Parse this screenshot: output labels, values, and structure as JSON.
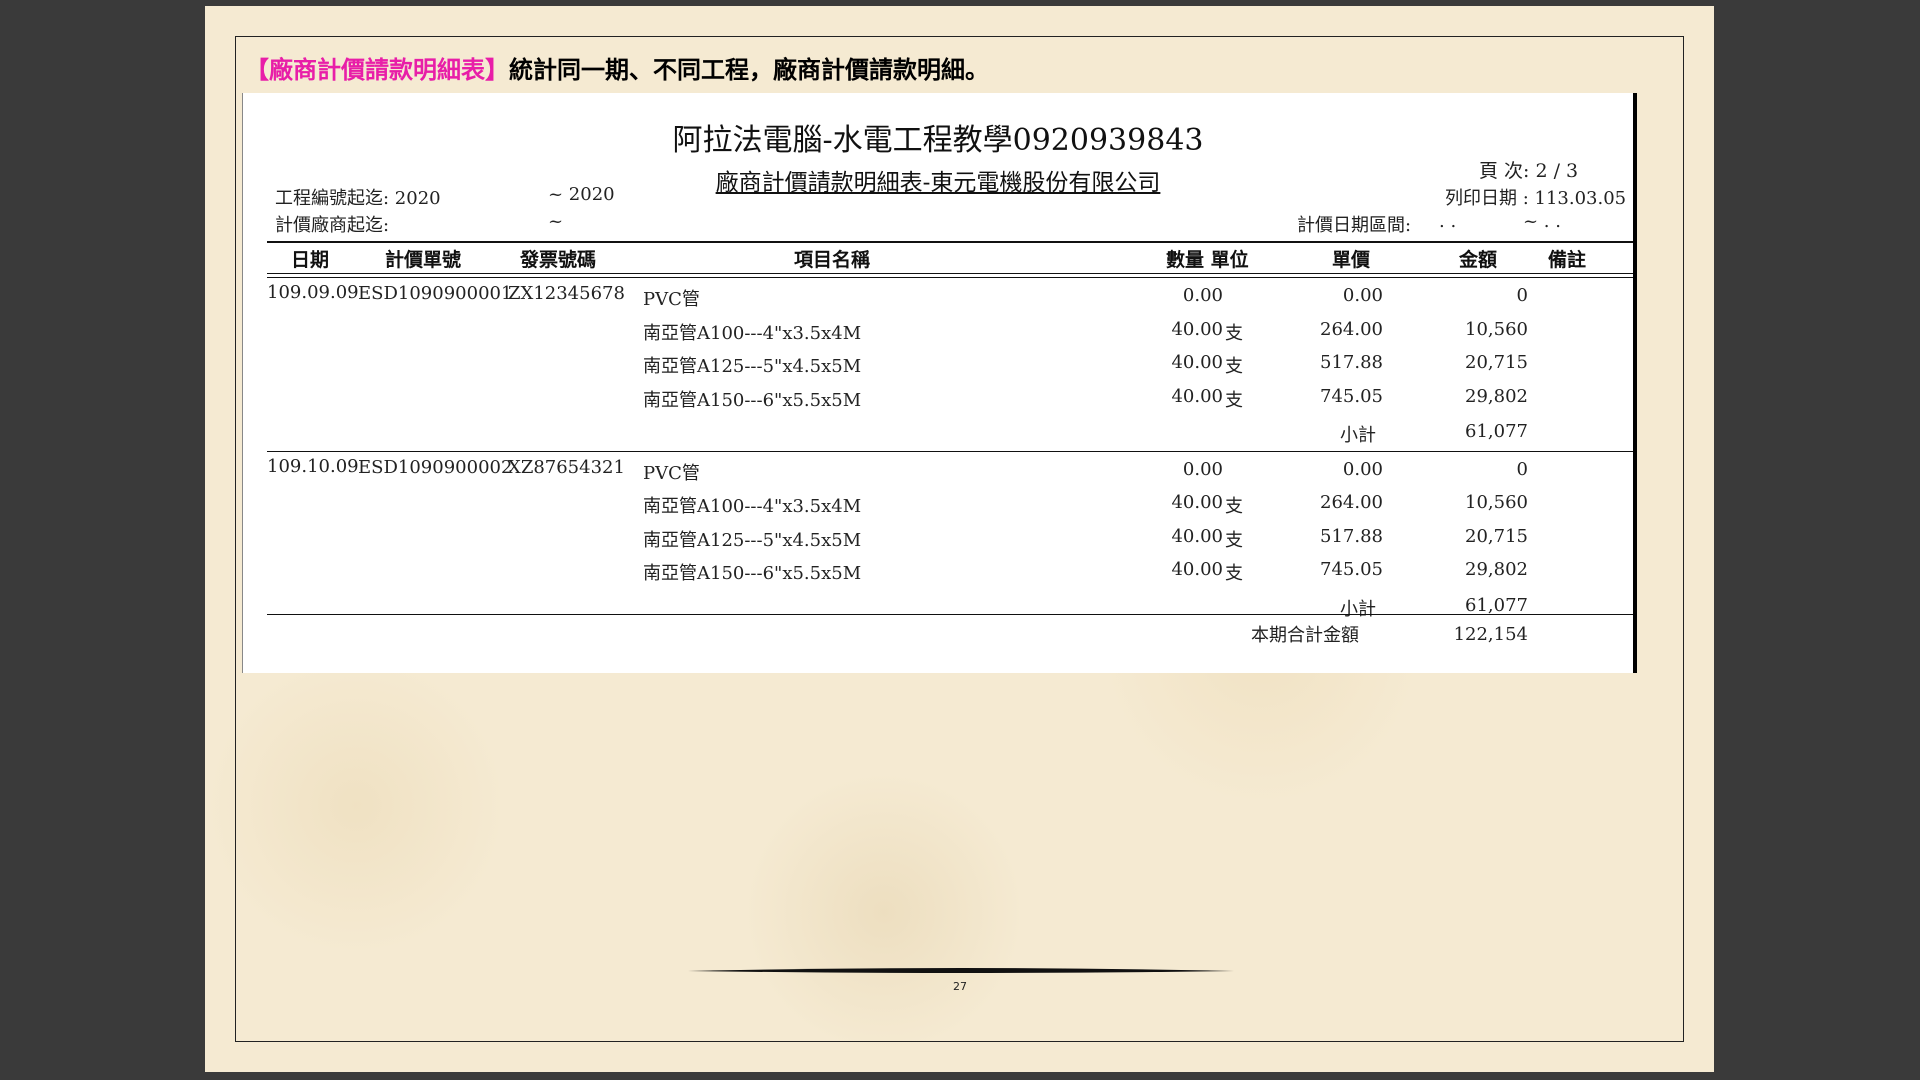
{
  "heading": {
    "tag": "【廠商計價請款明細表】",
    "text": "統計同一期、不同工程，廠商計價請款明細。"
  },
  "report": {
    "title": "阿拉法電腦-水電工程教學0920939843",
    "subtitle": "廠商計價請款明細表-東元電機股份有限公司",
    "project_range_label": "工程編號起迄: 2020",
    "project_range_end": "~ 2020",
    "vendor_range_label": "計價廠商起迄:",
    "vendor_range_end": "~",
    "page_label": "頁 次:  2  /  3",
    "print_date": "列印日期 : 113.03.05",
    "date_range_label": "計價日期區間:",
    "date_range_from": ". .",
    "date_range_to": "~  . .",
    "columns": {
      "date": "日期",
      "bill_no": "計價單號",
      "invoice_no": "發票號碼",
      "item": "項目名稱",
      "qty_unit": "數量 單位",
      "unit_price": "單價",
      "amount": "金額",
      "remark": "備註"
    },
    "groups": [
      {
        "date": "109.09.09",
        "bill_no": "ESD1090900001",
        "invoice_no": "ZX12345678",
        "items": [
          {
            "name": "PVC管",
            "qty": "0.00",
            "unit": "",
            "price": "0.00",
            "amount": "0"
          },
          {
            "name": "南亞管A100---4\"x3.5x4M",
            "qty": "40.00",
            "unit": "支",
            "price": "264.00",
            "amount": "10,560"
          },
          {
            "name": "南亞管A125---5\"x4.5x5M",
            "qty": "40.00",
            "unit": "支",
            "price": "517.88",
            "amount": "20,715"
          },
          {
            "name": "南亞管A150---6\"x5.5x5M",
            "qty": "40.00",
            "unit": "支",
            "price": "745.05",
            "amount": "29,802"
          }
        ],
        "subtotal_label": "小計",
        "subtotal": "61,077"
      },
      {
        "date": "109.10.09",
        "bill_no": "ESD1090900002",
        "invoice_no": "XZ87654321",
        "items": [
          {
            "name": "PVC管",
            "qty": "0.00",
            "unit": "",
            "price": "0.00",
            "amount": "0"
          },
          {
            "name": "南亞管A100---4\"x3.5x4M",
            "qty": "40.00",
            "unit": "支",
            "price": "264.00",
            "amount": "10,560"
          },
          {
            "name": "南亞管A125---5\"x4.5x5M",
            "qty": "40.00",
            "unit": "支",
            "price": "517.88",
            "amount": "20,715"
          },
          {
            "name": "南亞管A150---6\"x5.5x5M",
            "qty": "40.00",
            "unit": "支",
            "price": "745.05",
            "amount": "29,802"
          }
        ],
        "subtotal_label": "小計",
        "subtotal": "61,077"
      }
    ],
    "total_label": "本期合計金額",
    "total": "122,154"
  },
  "page_number": "27"
}
